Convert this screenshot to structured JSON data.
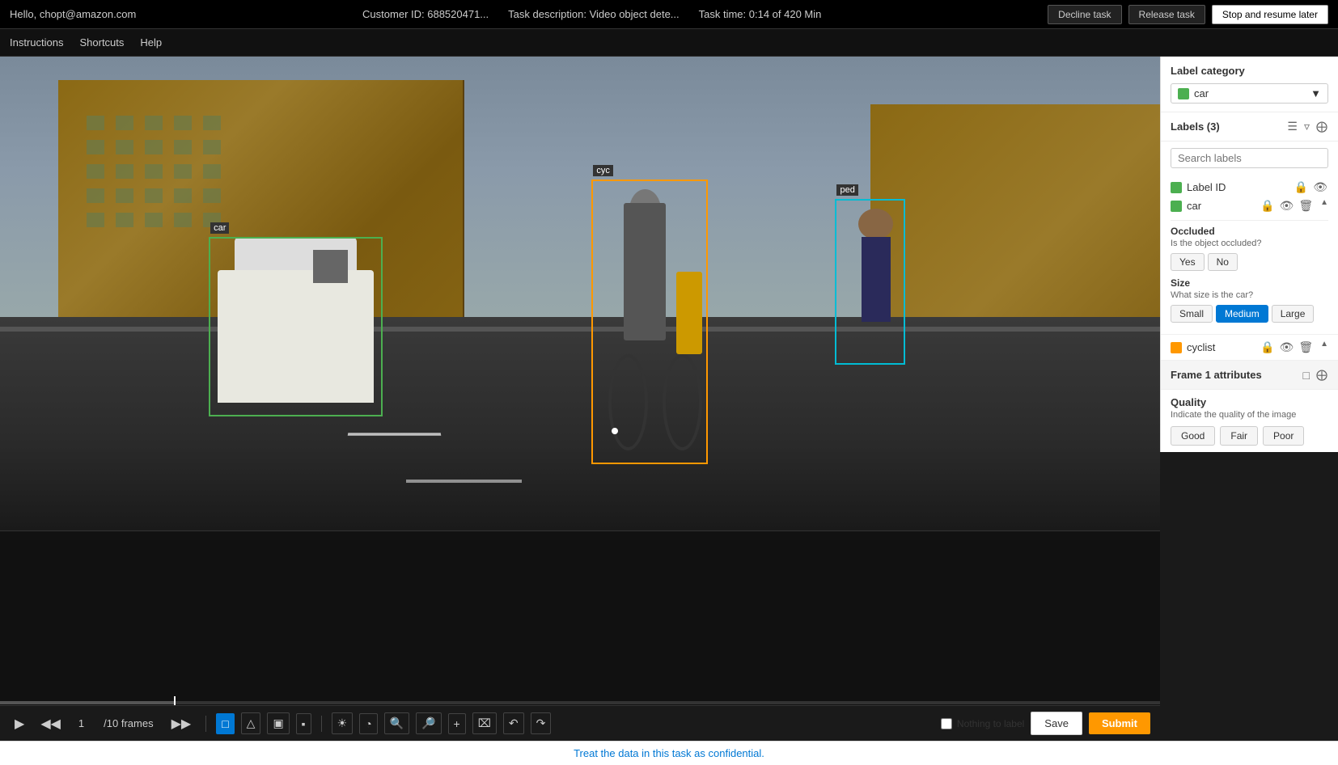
{
  "topbar": {
    "greeting": "Hello, chopt@amazon.com",
    "customer_id": "Customer ID: 688520471...",
    "task_desc": "Task description: Video object dete...",
    "task_time": "Task time: 0:14 of 420 Min",
    "decline_label": "Decline task",
    "release_label": "Release task",
    "stop_label": "Stop and resume later"
  },
  "navbar": {
    "instructions": "Instructions",
    "shortcuts": "Shortcuts",
    "help": "Help"
  },
  "sidebar": {
    "label_category_title": "Label category",
    "category_name": "car",
    "labels_title": "Labels",
    "labels_count_text": "Labels (3)",
    "search_placeholder": "Search labels",
    "label_id_title": "Label ID",
    "label_car_name": "car",
    "label_cyclist_name": "cyclist",
    "occluded_title": "Occluded",
    "occluded_question": "Is the object occluded?",
    "occluded_yes": "Yes",
    "occluded_no": "No",
    "size_title": "Size",
    "size_question": "What size is the car?",
    "size_small": "Small",
    "size_medium": "Medium",
    "size_large": "Large",
    "frame_attr_title": "Frame 1 attributes",
    "quality_title": "Quality",
    "quality_desc": "Indicate the quality of the image",
    "quality_good": "Good",
    "quality_fair": "Fair",
    "quality_poor": "Poor"
  },
  "playback": {
    "frame_current": "1",
    "frame_total": "/10 frames"
  },
  "bottom_bar": {
    "message": "Treat the data in this task as confidential."
  },
  "footer": {
    "nothing_to_label": "Nothing to label",
    "save_label": "Save",
    "submit_label": "Submit"
  },
  "boxes": {
    "car_label": "car",
    "cyclist_label": "cyc",
    "ped_label": "ped"
  }
}
